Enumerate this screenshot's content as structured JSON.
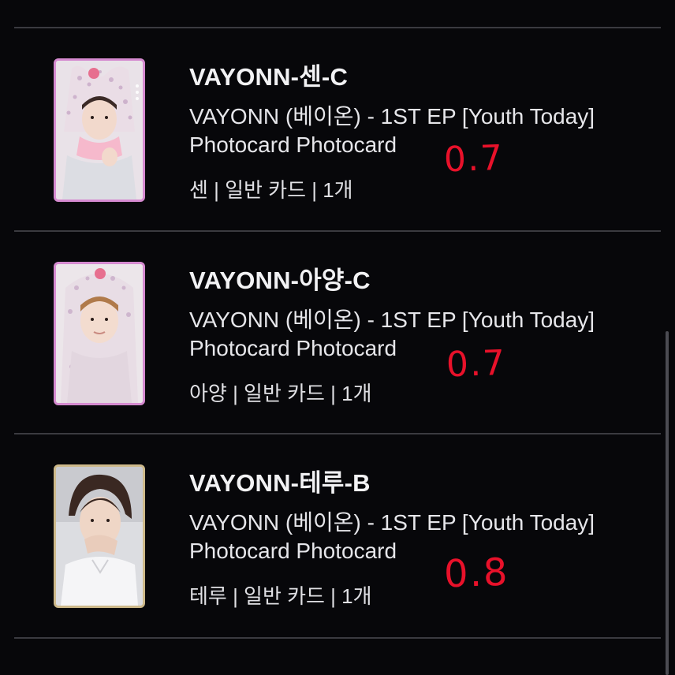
{
  "items": [
    {
      "title": "VAYONN-센-C",
      "desc_line1": "VAYONN (베이온) - 1ST EP [Youth Today]",
      "desc_line2": "Photocard Photocard",
      "meta": "센 | 일반 카드 | 1개",
      "handwritten_price": "0.7",
      "frame_color": "#d58ad0",
      "photo_icon": "photocard-hooded-member-icon"
    },
    {
      "title": "VAYONN-아양-C",
      "desc_line1": "VAYONN (베이온) - 1ST EP [Youth Today]",
      "desc_line2": "Photocard Photocard",
      "meta": "아양 | 일반 카드 | 1개",
      "handwritten_price": "0.7",
      "frame_color": "#d58ad0",
      "photo_icon": "photocard-hooded-member-icon"
    },
    {
      "title": "VAYONN-테루-B",
      "desc_line1": "VAYONN (베이온) - 1ST EP [Youth Today]",
      "desc_line2": "Photocard Photocard",
      "meta": "테루 | 일반 카드 | 1개",
      "handwritten_price": "0.8",
      "frame_color": "#cdb98a",
      "photo_icon": "photocard-member-portrait-icon"
    }
  ],
  "colors": {
    "background": "#07070a",
    "divider": "#3a3a40",
    "handwriting": "#e8112a"
  }
}
